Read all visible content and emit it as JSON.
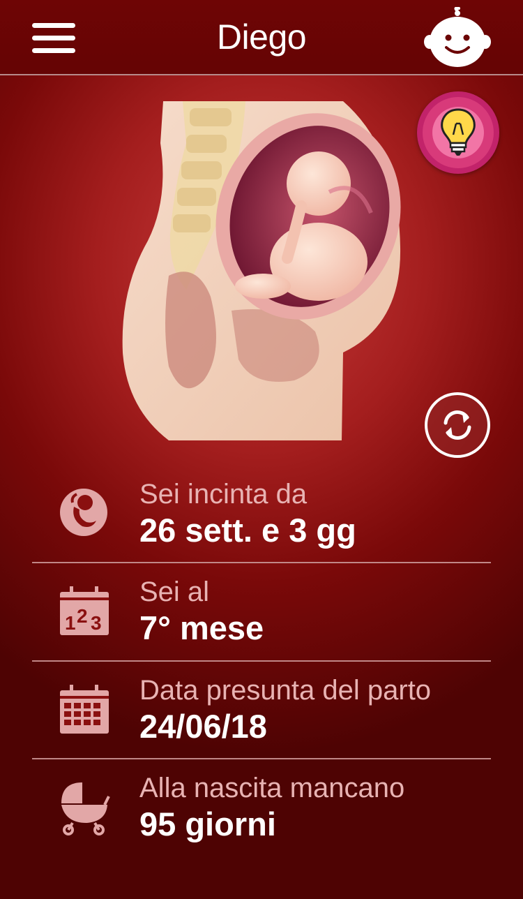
{
  "header": {
    "title": "Diego"
  },
  "icons": {
    "menu": "hamburger-menu-icon",
    "profile": "baby-face-icon",
    "tips": "lightbulb-icon",
    "switch_view": "refresh-arrows-icon"
  },
  "colors": {
    "background": "#8a1010",
    "header": "#6b0505",
    "tip_button": "#d83a7a",
    "label_text": "#e8b3b3",
    "icon_color": "#e2a7a7"
  },
  "stats": [
    {
      "label": "Sei incinta da",
      "value": "26 sett. e 3 gg",
      "icon": "fetus-circle-icon"
    },
    {
      "label": "Sei al",
      "value": "7° mese",
      "icon": "calendar-123-icon"
    },
    {
      "label": "Data presunta del parto",
      "value": "24/06/18",
      "icon": "calendar-grid-icon"
    },
    {
      "label": "Alla nascita mancano",
      "value": "95 giorni",
      "icon": "baby-stroller-icon"
    }
  ]
}
